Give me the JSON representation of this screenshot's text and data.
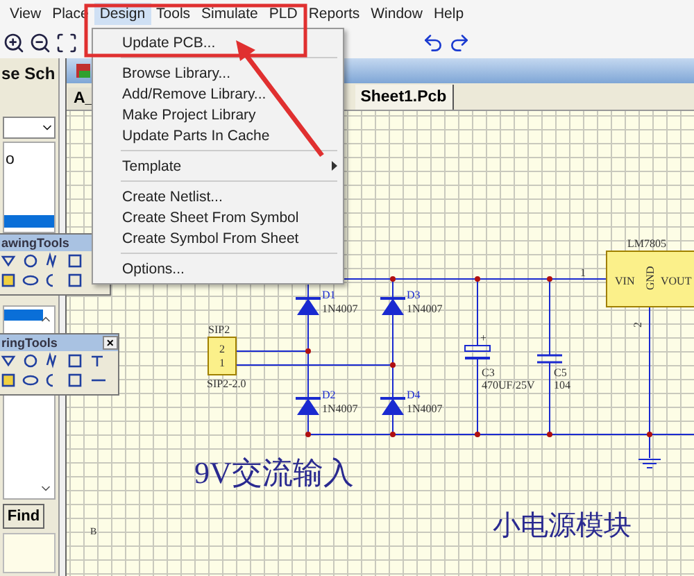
{
  "menu_bar": [
    {
      "label": "View",
      "selected": false
    },
    {
      "label": "Place",
      "selected": false
    },
    {
      "label": "Design",
      "selected": true
    },
    {
      "label": "Tools",
      "selected": false
    },
    {
      "label": "Simulate",
      "selected": false
    },
    {
      "label": "PLD",
      "selected": false
    },
    {
      "label": "Reports",
      "selected": false
    },
    {
      "label": "Window",
      "selected": false
    },
    {
      "label": "Help",
      "selected": false
    }
  ],
  "left_panel": {
    "title": "se Sch",
    "list_fragment": "o",
    "find_button": "Find"
  },
  "drawing_tools": {
    "title": "awingTools"
  },
  "wiring_tools": {
    "title": "ringTools",
    "close": "×"
  },
  "document": {
    "tabs": [
      {
        "label": "A_",
        "selected": false
      },
      {
        "label": "Sheet1.Pcb",
        "selected": true
      }
    ]
  },
  "schematic": {
    "ruler_label": "B",
    "connector": {
      "ref": "SIP2",
      "pins": [
        "2",
        "1"
      ],
      "footprint": "SIP2-2.0"
    },
    "diodes": [
      {
        "ref": "D1",
        "value": "1N4007"
      },
      {
        "ref": "D2",
        "value": "1N4007"
      },
      {
        "ref": "D3",
        "value": "1N4007"
      },
      {
        "ref": "D4",
        "value": "1N4007"
      }
    ],
    "capacitors": [
      {
        "kind": "polarized",
        "ref": "C3",
        "value": "470UF/25V",
        "pin_mark": "+"
      },
      {
        "kind": "ceramic",
        "ref": "C5",
        "value": "104"
      }
    ],
    "regulator": {
      "ref": "LM7805",
      "pins": [
        "VIN",
        "GND",
        "VOUT"
      ],
      "pin_numbers": [
        "1",
        "2"
      ]
    },
    "labels": [
      "9V交流输入",
      "小电源模块"
    ]
  },
  "design_menu": [
    {
      "kind": "item",
      "label": "Update PCB..."
    },
    {
      "kind": "separator"
    },
    {
      "kind": "item",
      "label": "Browse Library..."
    },
    {
      "kind": "item",
      "label": "Add/Remove Library..."
    },
    {
      "kind": "item",
      "label": "Make Project Library"
    },
    {
      "kind": "item",
      "label": "Update Parts In Cache"
    },
    {
      "kind": "separator"
    },
    {
      "kind": "submenu",
      "label": "Template"
    },
    {
      "kind": "separator"
    },
    {
      "kind": "item",
      "label": "Create Netlist..."
    },
    {
      "kind": "item",
      "label": "Create Sheet From Symbol"
    },
    {
      "kind": "item",
      "label": "Create Symbol From Sheet"
    },
    {
      "kind": "separator"
    },
    {
      "kind": "item",
      "label": "Options..."
    }
  ]
}
